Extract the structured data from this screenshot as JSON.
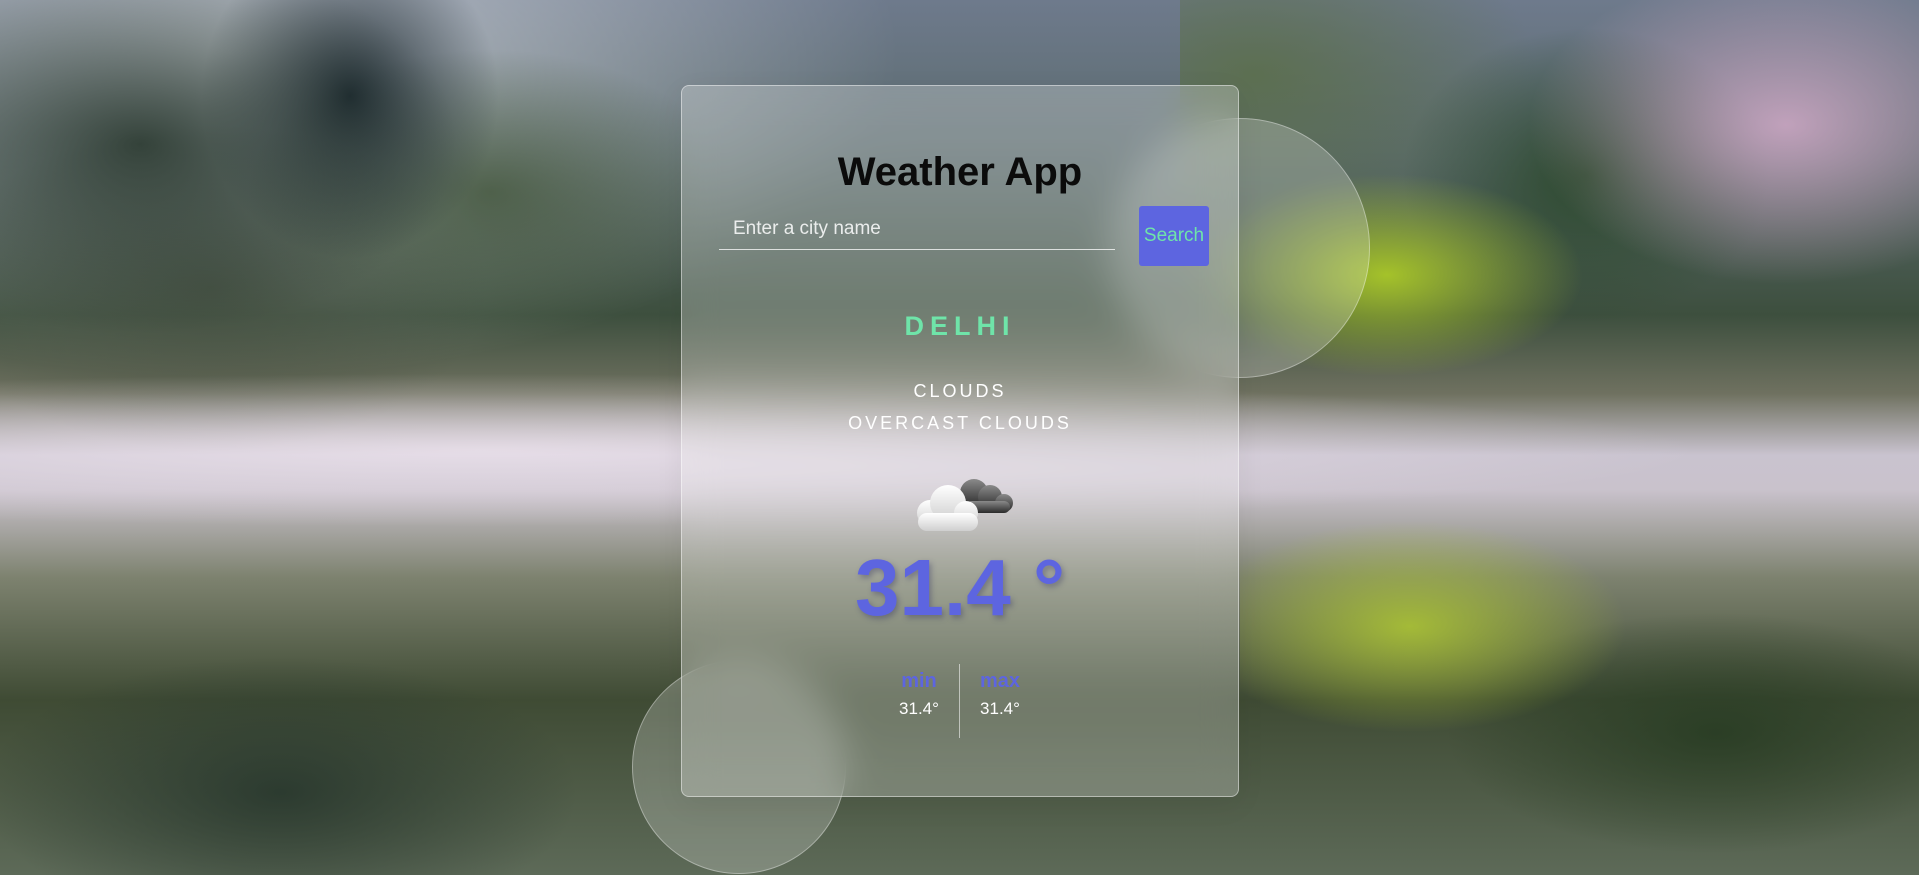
{
  "app": {
    "title": "Weather App"
  },
  "search": {
    "placeholder": "Enter a city name",
    "value": "",
    "button_label": "Search"
  },
  "weather": {
    "city": "DELHI",
    "condition_main": "CLOUDS",
    "condition_description": "OVERCAST CLOUDS",
    "icon": "clouds-icon",
    "temperature": "31.4 °",
    "min_label": "min",
    "min_value": "31.4°",
    "max_label": "max",
    "max_value": "31.4°"
  },
  "colors": {
    "accent": "#5d65e0",
    "city": "#6fe4a9",
    "title": "#0b0b0b"
  }
}
